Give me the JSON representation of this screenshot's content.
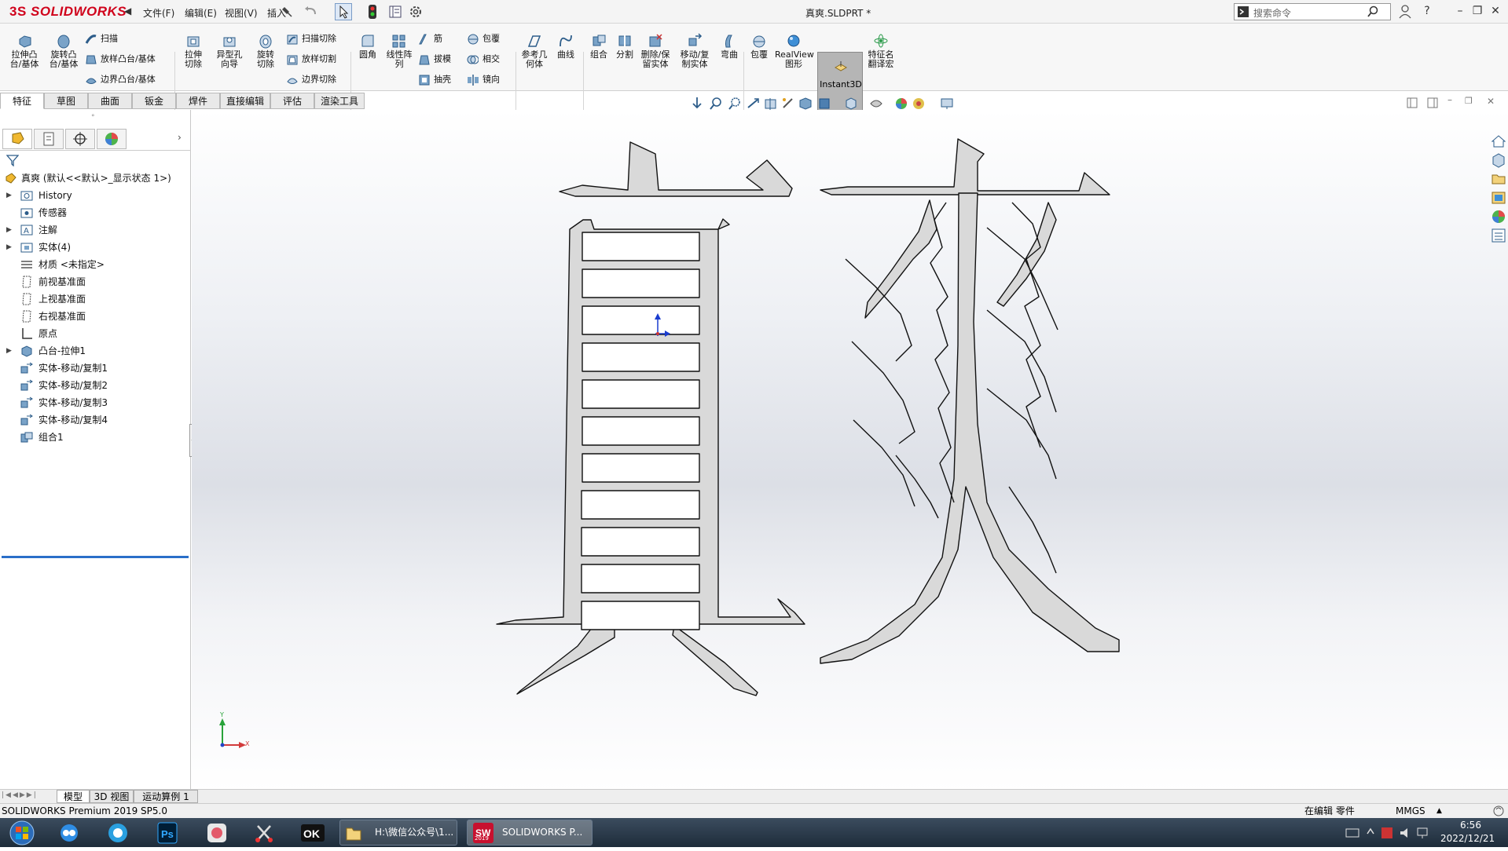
{
  "app": {
    "logo_ds": "3S",
    "logo_text": "SOLIDWORKS",
    "document_title": "真爽.SLDPRT *"
  },
  "menu": [
    {
      "label": "文件(F)"
    },
    {
      "label": "编辑(E)"
    },
    {
      "label": "视图(V)"
    },
    {
      "label": "插入"
    }
  ],
  "search": {
    "placeholder": "搜索命令"
  },
  "ribbon": {
    "extrude_boss": "拉伸凸台/基体",
    "revolve_boss": "旋转凸台/基体",
    "sweep": "扫描",
    "loft_boss": "放样凸台/基体",
    "boundary_boss": "边界凸台/基体",
    "extrude_cut": "拉伸切除",
    "hole_wizard": "异型孔向导",
    "revolve_cut": "旋转切除",
    "swept_cut": "扫描切除",
    "lofted_cut": "放样切割",
    "boundary_cut": "边界切除",
    "fillet": "圆角",
    "linear_pattern": "线性阵列",
    "rib": "筋",
    "draft": "拔模",
    "shell": "抽壳",
    "wrap": "包覆",
    "intersect": "相交",
    "mirror": "镜向",
    "ref_geometry": "参考几何体",
    "curves": "曲线",
    "combine": "组合",
    "split": "分割",
    "delete_keep_body": "删除/保留实体",
    "move_copy_body": "移动/复制实体",
    "flex": "弯曲",
    "wrap2": "包覆",
    "realview": "RealView 图形",
    "instant3d": "Instant3D",
    "feature_name_translate": "特征名翻译宏"
  },
  "command_tabs": [
    "特征",
    "草图",
    "曲面",
    "钣金",
    "焊件",
    "直接编辑",
    "评估",
    "渲染工具"
  ],
  "tree": {
    "root": "真爽 (默认<<默认>_显示状态 1>)",
    "items": [
      {
        "label": "History"
      },
      {
        "label": "传感器"
      },
      {
        "label": "注解"
      },
      {
        "label": "实体(4)"
      },
      {
        "label": "材质 <未指定>"
      },
      {
        "label": "前视基准面"
      },
      {
        "label": "上视基准面"
      },
      {
        "label": "右视基准面"
      },
      {
        "label": "原点"
      },
      {
        "label": "凸台-拉伸1"
      },
      {
        "label": "实体-移动/复制1"
      },
      {
        "label": "实体-移动/复制2"
      },
      {
        "label": "实体-移动/复制3"
      },
      {
        "label": "实体-移动/复制4"
      },
      {
        "label": "组合1"
      }
    ]
  },
  "triad": {
    "x": "X",
    "y": "Y"
  },
  "bottom_tabs": [
    "模型",
    "3D 视图",
    "运动算例 1"
  ],
  "status": {
    "product": "SOLIDWORKS Premium 2019 SP5.0",
    "editing": "在编辑 零件",
    "units": "MMGS"
  },
  "taskbar": {
    "explorer_window": "H:\\微信公众号\\1...",
    "solidworks_window": "SOLIDWORKS P...",
    "time": "6:56",
    "date": "2022/12/21",
    "sw_badge": "2019"
  },
  "colors": {
    "logo_red": "#d0021b",
    "selection_blue": "#2a6fc9",
    "model_fill": "#d9d9d9",
    "taskbar": "#24384c"
  }
}
